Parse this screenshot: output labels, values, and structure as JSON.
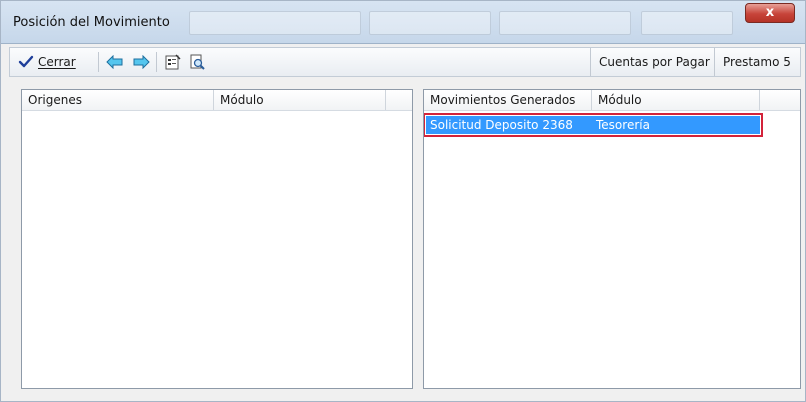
{
  "window": {
    "title": "Posición del Movimiento",
    "close_glyph": "x"
  },
  "toolbar": {
    "cerrar_label": "Cerrar",
    "buttons": [
      "check-icon",
      "arrow-left-icon",
      "arrow-right-icon",
      "properties-icon",
      "preview-icon"
    ],
    "status": {
      "left": "Cuentas por Pagar",
      "right": "Prestamo 5"
    }
  },
  "left_list": {
    "headers": [
      "Origenes",
      "Módulo"
    ],
    "rows": []
  },
  "right_list": {
    "headers": [
      "Movimientos Generados",
      "Módulo"
    ],
    "rows": [
      {
        "movimiento": "Solicitud Deposito 2368",
        "modulo": "Tesorería",
        "selected": true
      }
    ]
  },
  "colors": {
    "selection": "#3399ff",
    "highlight_box": "#d3233a",
    "close_button": "#c7443a"
  }
}
